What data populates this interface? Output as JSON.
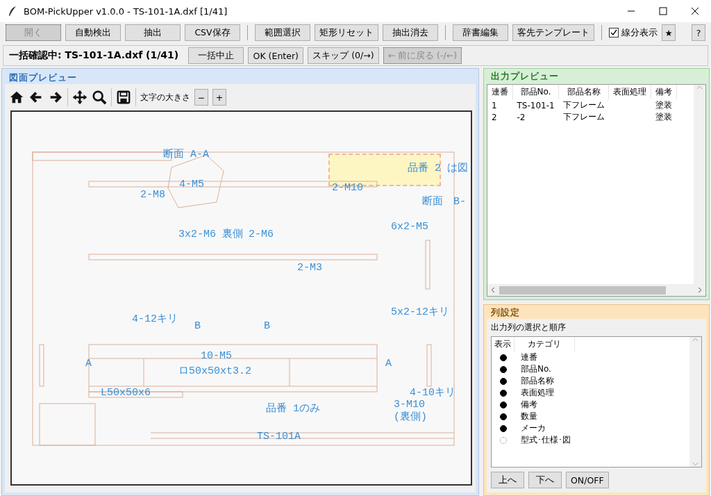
{
  "window": {
    "title": "BOM-PickUpper v1.0.0 - TS-101-1A.dxf [1/41]"
  },
  "toolbar": [
    {
      "kind": "button",
      "label": "開く",
      "disabled": true
    },
    {
      "kind": "button",
      "label": "自動検出",
      "disabled": false
    },
    {
      "kind": "button",
      "label": "抽出",
      "disabled": false
    },
    {
      "kind": "button",
      "label": "CSV保存",
      "disabled": false
    },
    {
      "kind": "separator"
    },
    {
      "kind": "button",
      "label": "範囲選択",
      "disabled": false
    },
    {
      "kind": "button",
      "label": "矩形リセット",
      "disabled": false
    },
    {
      "kind": "button",
      "label": "抽出消去",
      "disabled": false
    },
    {
      "kind": "separator"
    },
    {
      "kind": "button",
      "label": "辞書編集",
      "disabled": false
    },
    {
      "kind": "button",
      "label": "客先テンプレート",
      "disabled": false
    },
    {
      "kind": "separator"
    },
    {
      "kind": "checkbox",
      "label": "線分表示",
      "checked": true
    },
    {
      "kind": "button",
      "label": "★",
      "disabled": false
    }
  ],
  "help_button": "?",
  "batch_bar": {
    "status": "一括確認中: TS-101-1A.dxf (1/41)",
    "buttons": [
      {
        "label": "一括中止",
        "disabled": false
      },
      {
        "label": "OK (Enter)",
        "disabled": false
      },
      {
        "label": "スキップ (0/→)",
        "disabled": false
      },
      {
        "label": "← 前に戻る (-/←)",
        "disabled": true
      }
    ]
  },
  "drawing_preview": {
    "title": "図面プレビュー",
    "font_size_label": "文字の大きさ",
    "font_size_buttons": [
      "−",
      "+"
    ],
    "drawing_labels": [
      "断面 A-A",
      "品番 2 は図",
      "4-M5",
      "2-M8",
      "2-M10",
      "断面　B-",
      "6x2-M5",
      "3x2-M6 裏側",
      "2-M6",
      "2-M3",
      "5x2-12キリ",
      "4-12キリ",
      "B",
      "B",
      "10-M5",
      "A",
      "ロ50x50xt3.2",
      "A",
      "L50x50x6",
      "4-10キリ",
      "3-M10",
      "(裏側)",
      "品番 1のみ",
      "TS-101A"
    ]
  },
  "output_preview": {
    "title": "出力プレビュー",
    "columns": [
      "連番",
      "部品No.",
      "部品名称",
      "表面処理",
      "備考"
    ],
    "rows": [
      [
        "1",
        "TS-101-1",
        "下フレーム",
        "",
        "塗装"
      ],
      [
        "2",
        "-2",
        "下フレーム",
        "",
        "塗装"
      ]
    ]
  },
  "column_settings": {
    "title": "列設定",
    "group_title": "出力列の選択と順序",
    "list_headers": [
      "表示",
      "カテゴリ"
    ],
    "items": [
      {
        "label": "連番",
        "on": true
      },
      {
        "label": "部品No.",
        "on": true
      },
      {
        "label": "部品名称",
        "on": true
      },
      {
        "label": "表面処理",
        "on": true
      },
      {
        "label": "備考",
        "on": true
      },
      {
        "label": "数量",
        "on": true
      },
      {
        "label": "メーカ",
        "on": true
      },
      {
        "label": "型式･仕様･図",
        "on": false
      }
    ],
    "buttons": [
      "上へ",
      "下へ",
      "ON/OFF"
    ]
  }
}
